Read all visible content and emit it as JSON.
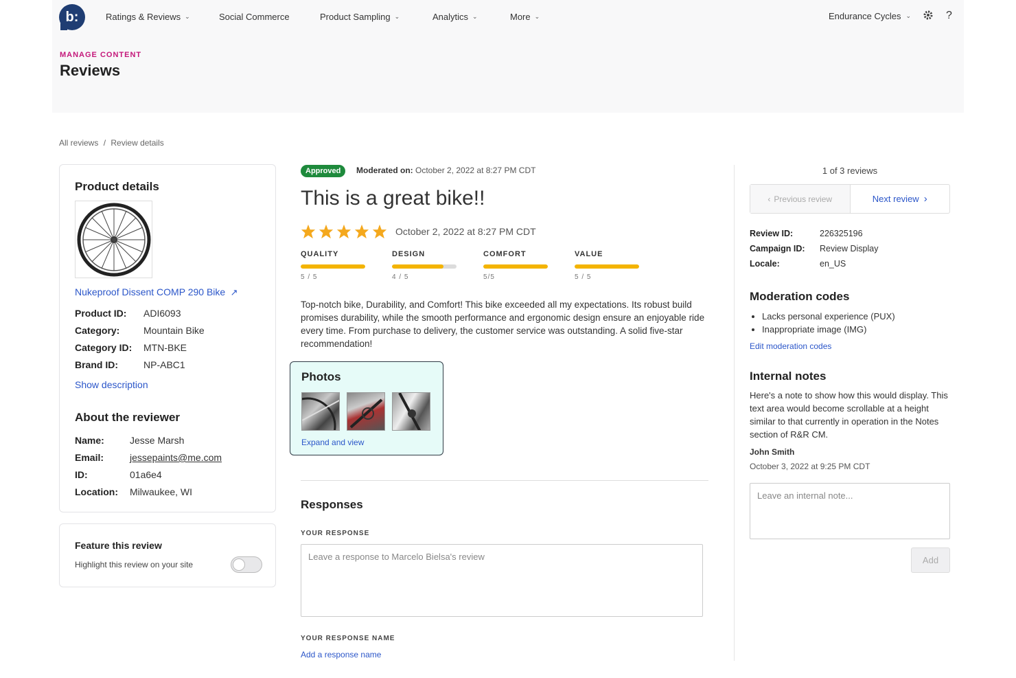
{
  "nav": {
    "logo_text": "b:",
    "items": [
      {
        "label": "Ratings & Reviews",
        "has_menu": true
      },
      {
        "label": "Social Commerce",
        "has_menu": false
      },
      {
        "label": "Product Sampling",
        "has_menu": true
      },
      {
        "label": "Analytics",
        "has_menu": true
      },
      {
        "label": "More",
        "has_menu": true
      }
    ],
    "account": "Endurance Cycles",
    "settings_icon": "gear-icon",
    "help_icon": "?"
  },
  "header": {
    "eyebrow": "MANAGE CONTENT",
    "title": "Reviews"
  },
  "breadcrumb": {
    "all": "All reviews",
    "sep": "/",
    "current": "Review details"
  },
  "product": {
    "heading": "Product details",
    "name": "Nukeproof Dissent COMP 290 Bike",
    "fields": [
      {
        "key": "Product ID:",
        "value": "ADI6093"
      },
      {
        "key": "Category:",
        "value": "Mountain Bike"
      },
      {
        "key": "Category ID:",
        "value": "MTN-BKE"
      },
      {
        "key": "Brand ID:",
        "value": "NP-ABC1"
      }
    ],
    "show_description": "Show description"
  },
  "reviewer": {
    "heading": "About the reviewer",
    "fields": [
      {
        "key": "Name:",
        "value": "Jesse Marsh"
      },
      {
        "key": "Email:",
        "value": "jessepaints@me.com"
      },
      {
        "key": "ID:",
        "value": "01a6e4"
      },
      {
        "key": "Location:",
        "value": "Milwaukee, WI"
      }
    ]
  },
  "feature": {
    "heading": "Feature this review",
    "description": "Highlight this review on your site",
    "enabled": false
  },
  "review": {
    "status_badge": "Approved",
    "moderated_label": "Moderated on:",
    "moderated_date": "October 2, 2022 at 8:27 PM CDT",
    "title": "This is a great bike!!",
    "rating": 5,
    "date": "October 2, 2022 at 8:27 PM CDT",
    "sub_ratings": [
      {
        "label": "QUALITY",
        "score": "5 / 5",
        "value": 5
      },
      {
        "label": "DESIGN",
        "score": "4 / 5",
        "value": 4
      },
      {
        "label": "COMFORT",
        "score": "5/5",
        "value": 5
      },
      {
        "label": "VALUE",
        "score": "5 / 5",
        "value": 5
      }
    ],
    "body": "Top-notch bike, Durability, and Comfort! This bike exceeded all my expectations. Its robust build promises durability, while the smooth performance and ergonomic design ensure an enjoyable ride every time. From purchase to delivery, the customer service was outstanding. A solid five-star recommendation!",
    "photos_heading": "Photos",
    "expand_link": "Expand and view"
  },
  "responses": {
    "heading": "Responses",
    "your_response_label": "YOUR RESPONSE",
    "response_placeholder": "Leave a response to Marcelo Bielsa's review",
    "response_name_label": "YOUR RESPONSE NAME",
    "add_name_link": "Add a response name"
  },
  "sidebar": {
    "counter": "1 of 3 reviews",
    "prev_label": "Previous review",
    "next_label": "Next review",
    "meta": [
      {
        "key": "Review ID:",
        "value": "226325196"
      },
      {
        "key": "Campaign ID:",
        "value": "Review Display"
      },
      {
        "key": "Locale:",
        "value": "en_US"
      }
    ],
    "moderation_heading": "Moderation codes",
    "moderation_codes": [
      "Lacks personal experience (PUX)",
      "Inappropriate image (IMG)"
    ],
    "edit_codes_link": "Edit moderation codes",
    "notes_heading": "Internal notes",
    "note_text": "Here's a note to show how this would display. This text area would become scrollable at a height similar to that currently in operation in the Notes section of R&R CM.",
    "note_author": "John Smith",
    "note_date": "October 3, 2022 at 9:25 PM CDT",
    "note_placeholder": "Leave an internal note...",
    "add_button": "Add"
  },
  "colors": {
    "accent": "#c4177a",
    "link": "#2b56c9",
    "approved": "#1e8a3c",
    "star": "#f4a81d",
    "photos_bg": "#e6fbf8"
  }
}
